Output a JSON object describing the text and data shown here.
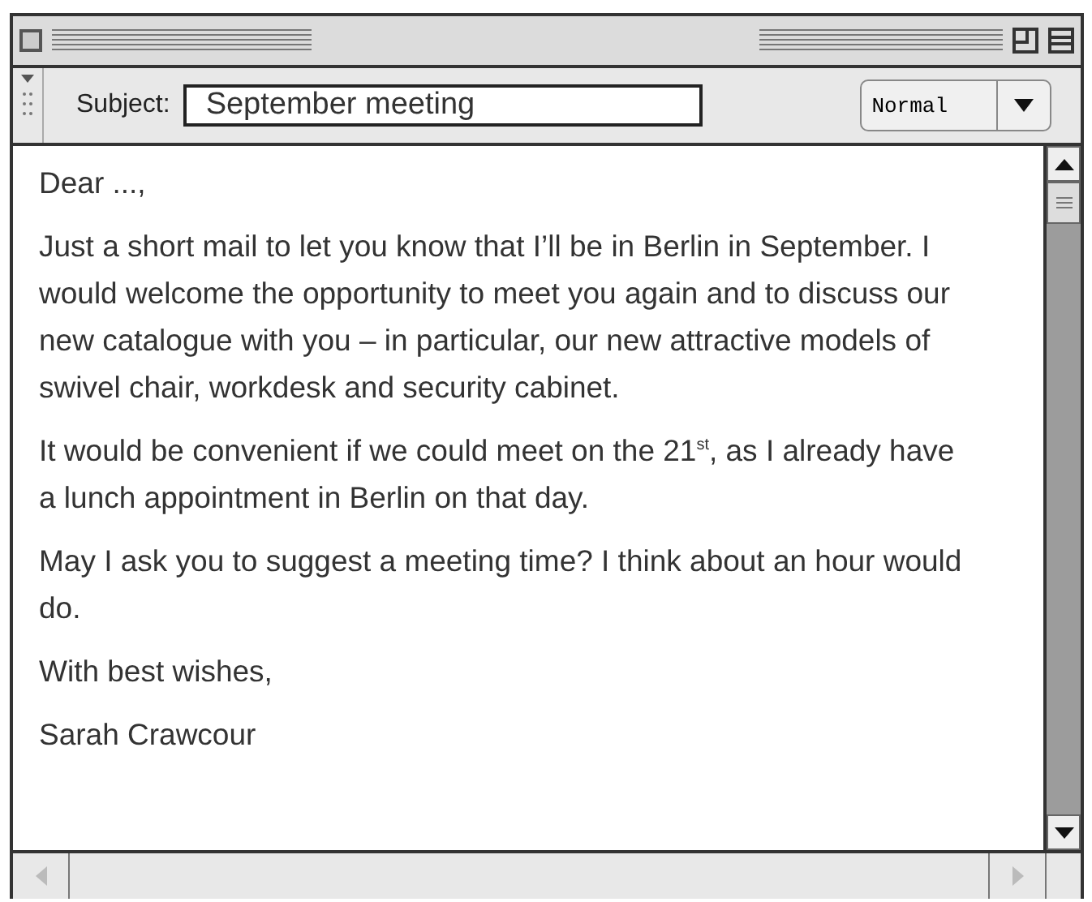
{
  "toolbar": {
    "subject_label": "Subject:",
    "subject_value": "September meeting",
    "format_menu": "Normal"
  },
  "body": {
    "paragraphs": [
      "Dear ...,",
      "Just a short mail to let you know that I’ll be in Berlin in September. I would welcome the opportunity to meet you again and to discuss our new catalogue with you – in particular, our new attractive models of swivel chair, workdesk and security cabinet.",
      "It would be convenient if we could meet on the 21$^{st}$, as I already have a lunch appointment in Berlin on that day.",
      "May I ask you to suggest a meeting time? I think about an hour would do.",
      "With best wishes,",
      "Sarah Crawcour"
    ]
  }
}
